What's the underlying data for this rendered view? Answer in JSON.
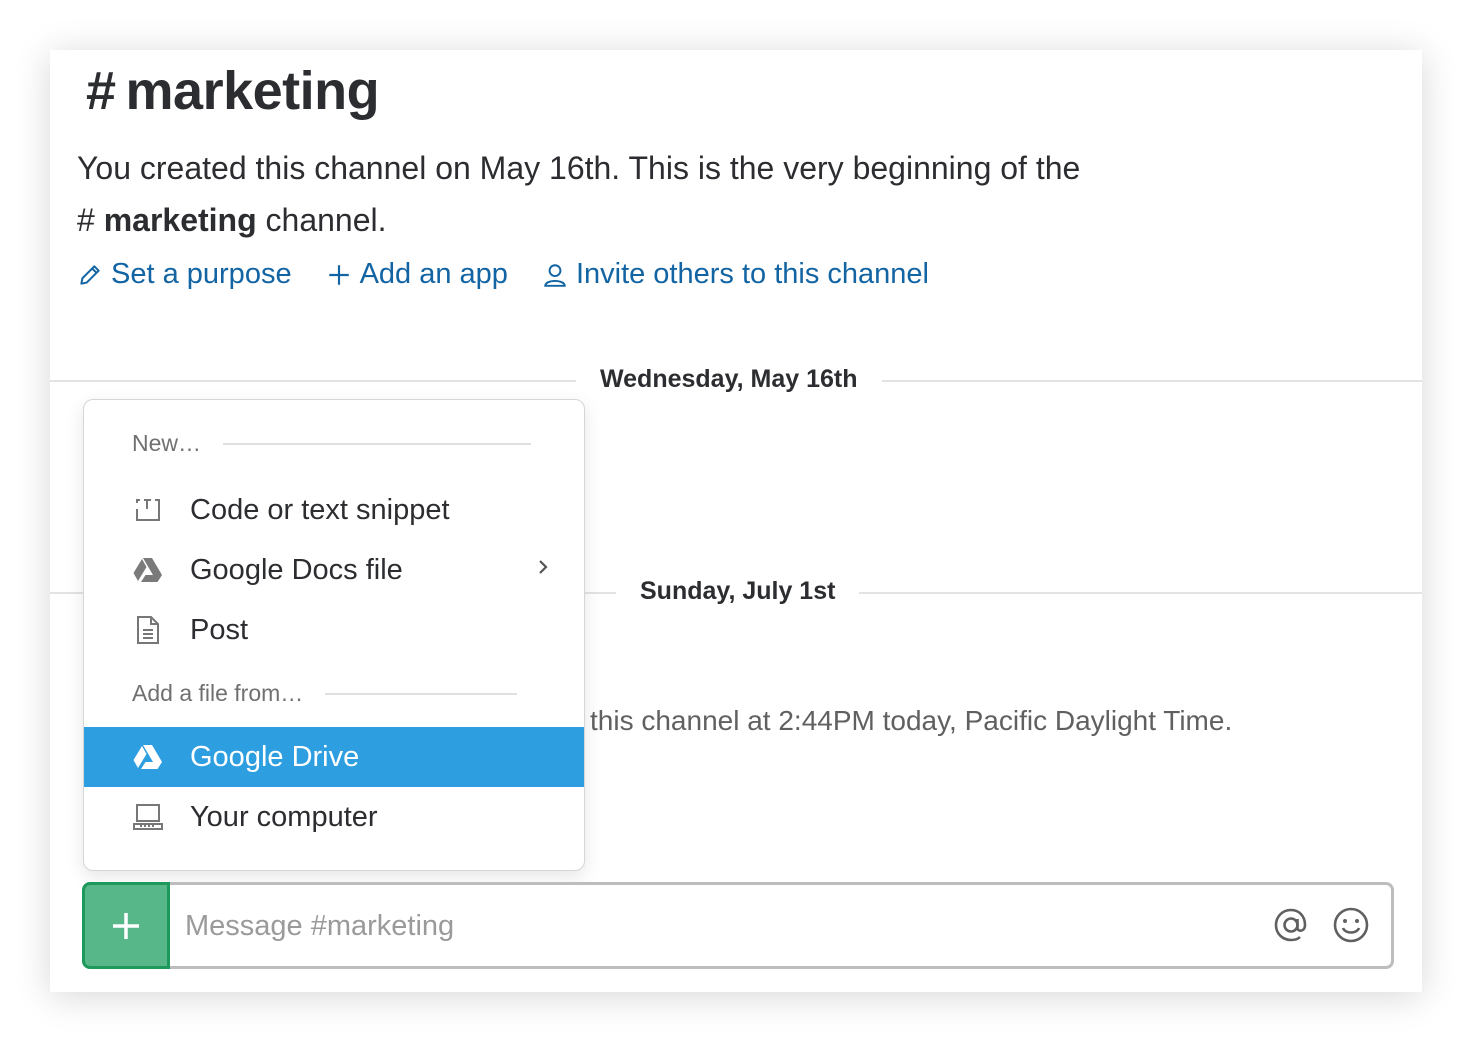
{
  "channel": {
    "hash": "#",
    "name": "marketing"
  },
  "intro": {
    "line1": "You created this channel on May 16th. This is the very beginning of the",
    "hash": "#",
    "channel_name": "marketing",
    "suffix": " channel."
  },
  "actions": [
    {
      "label": "Set a purpose",
      "icon": "pencil-icon"
    },
    {
      "label": "Add an app",
      "icon": "plus-icon"
    },
    {
      "label": "Invite others to this channel",
      "icon": "person-icon"
    }
  ],
  "dates": [
    "Wednesday, May 16th",
    "Sunday, July 1st"
  ],
  "message_fragment": "this channel at 2:44PM today, Pacific Daylight Time.",
  "menu": {
    "heading_new": "New…",
    "heading_add": "Add a file from…",
    "new_items": [
      {
        "label": "Code or text snippet",
        "icon": "snippet-icon"
      },
      {
        "label": "Google Docs file",
        "icon": "google-drive-icon",
        "has_submenu": true
      },
      {
        "label": "Post",
        "icon": "document-icon"
      }
    ],
    "file_items": [
      {
        "label": "Google Drive",
        "icon": "google-drive-icon",
        "active": true
      },
      {
        "label": "Your computer",
        "icon": "laptop-icon"
      }
    ]
  },
  "composer": {
    "placeholder": "Message #marketing",
    "value": ""
  },
  "colors": {
    "link": "#1264a3",
    "menu_active": "#2d9ee0",
    "plus_button": "#57b788"
  }
}
